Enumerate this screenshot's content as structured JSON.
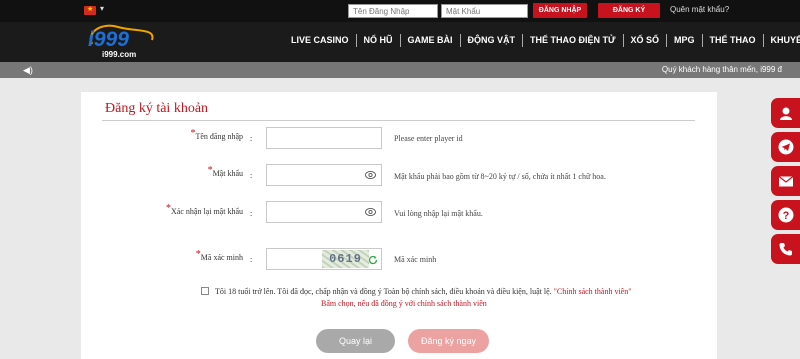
{
  "topbar": {
    "flag_icon": "vietnam-flag-icon",
    "flag_star": "★",
    "caret": "▾",
    "username_placeholder": "Tên Đăng Nhập",
    "password_placeholder": "Mật Khẩu",
    "login_label": "ĐĂNG NHẬP",
    "register_label": "ĐĂNG KÝ",
    "forgot_label": "Quên mật khẩu?"
  },
  "logo": {
    "text": "i999",
    "domain": ".com"
  },
  "nav": {
    "items": [
      "LIVE CASINO",
      "NỔ HŨ",
      "GAME BÀI",
      "ĐỘNG VẬT",
      "THỂ THAO ĐIỆN TỬ",
      "XỔ SỐ",
      "MPG",
      "THỂ THAO",
      "KHUYẾN MÃI"
    ]
  },
  "ticker": {
    "text": "Quý khách hàng thân mến, i999 đ"
  },
  "form": {
    "title": "Đăng ký tài khoản",
    "required_mark": "*",
    "colon": ":",
    "username": {
      "label": "Tên đăng nhập",
      "hint": "Please enter player id"
    },
    "password": {
      "label": "Mật khẩu",
      "hint": "Mật khẩu phải bao gồm từ 8~20 ký tự / số, chứa ít nhất 1 chữ hoa."
    },
    "confirm": {
      "label": "Xác nhận lại mật khẩu",
      "hint": "Vui lòng nhập lại mật khẩu."
    },
    "captcha": {
      "label": "Mã xác minh",
      "code": "0619",
      "hint": "Mã xác minh"
    },
    "agree_text": "Tôi 18 tuổi trở lên. Tôi đã đọc, chấp nhận và đồng ý Toàn bộ chính sách, điều khoản và điều kiện, luật lệ.",
    "agree_link": "\"Chính sách thành viên\"",
    "agree_note": "Bấm chọn, nếu đã đồng ý với chính sách thành viên",
    "back_label": "Quay lại",
    "submit_label": "Đăng ký ngay"
  },
  "colors": {
    "brand_red": "#c8131f",
    "nav_bg": "#1b1b1b",
    "submit_pink": "#eda2a2",
    "back_gray": "#a9a9a9"
  },
  "side_buttons": [
    "support-agent-icon",
    "telegram-icon",
    "mail-icon",
    "help-icon",
    "phone-icon"
  ]
}
